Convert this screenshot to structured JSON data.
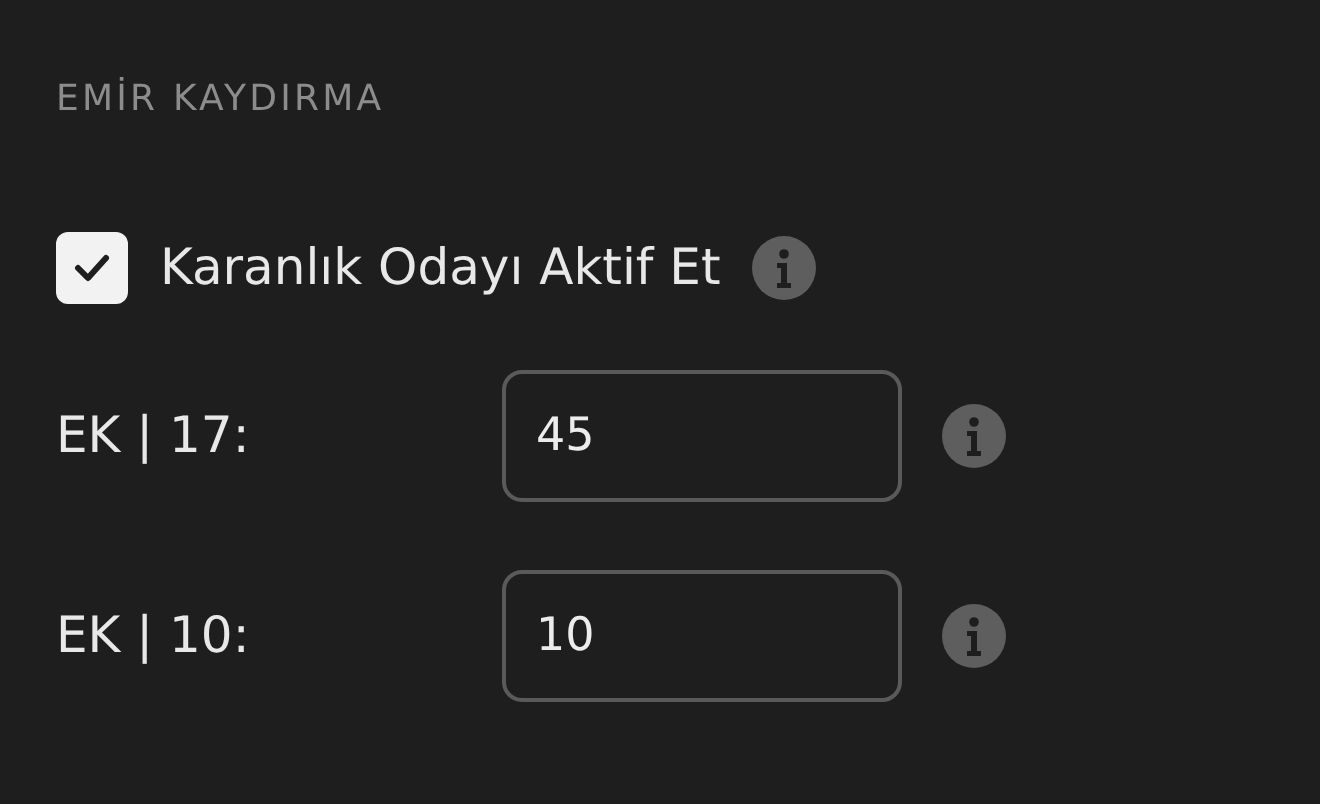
{
  "section_title": "EMİR KAYDIRMA",
  "dark_room": {
    "label": "Karanlık Odayı Aktif Et",
    "checked": true
  },
  "fields": [
    {
      "label": "EK | 17:",
      "value": "45"
    },
    {
      "label": "EK | 10:",
      "value": "10"
    }
  ]
}
